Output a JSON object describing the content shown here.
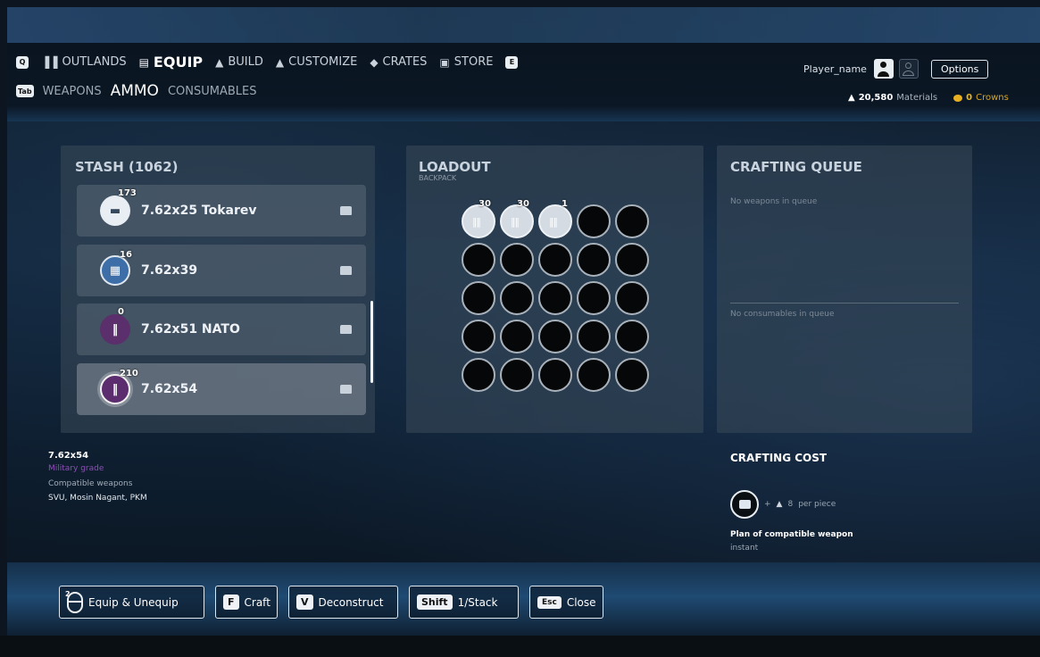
{
  "nav": {
    "prev_key": "Q",
    "next_key": "E",
    "tabs": [
      {
        "label": "OUTLANDS",
        "icon": "bars-icon"
      },
      {
        "label": "EQUIP",
        "icon": "gun-icon"
      },
      {
        "label": "BUILD",
        "icon": "house-icon"
      },
      {
        "label": "CUSTOMIZE",
        "icon": "helmet-icon"
      },
      {
        "label": "CRATES",
        "icon": "crate-icon"
      },
      {
        "label": "STORE",
        "icon": "store-icon"
      }
    ]
  },
  "subnav": {
    "key": "Tab",
    "tabs": [
      "WEAPONS",
      "AMMO",
      "CONSUMABLES"
    ]
  },
  "player": {
    "name": "Player_name",
    "options_label": "Options"
  },
  "currency": {
    "materials_value": "20,580",
    "materials_label": "Materials",
    "crowns_value": "0",
    "crowns_label": "Crowns",
    "crowns_color": "#e8b41e"
  },
  "stash": {
    "title": "STASH (1062)",
    "items": [
      {
        "name": "7.62x25 Tokarev",
        "count": "173",
        "icon": "bullet-icon"
      },
      {
        "name": "7.62x39",
        "count": "16",
        "icon": "magazine-icon"
      },
      {
        "name": "7.62x51 NATO",
        "count": "0",
        "icon": "cartridges-icon"
      },
      {
        "name": "7.62x54",
        "count": "210",
        "icon": "cartridges-icon"
      }
    ]
  },
  "loadout": {
    "title": "LOADOUT",
    "subtitle": "BACKPACK",
    "filled_counts": [
      "30",
      "30",
      "1"
    ]
  },
  "crafting_queue": {
    "title": "CRAFTING QUEUE",
    "weapons_empty": "No weapons in queue",
    "consumables_empty": "No consumables in queue"
  },
  "info": {
    "title": "7.62x54",
    "grade": "Military grade",
    "grade_color": "#8d4fb5",
    "compat_label": "Compatible weapons",
    "compat": "SVU, Mosin Nagant, PKM"
  },
  "crafting_cost": {
    "title": "CRAFTING COST",
    "plus": "+",
    "amount": "8",
    "per_piece": "per piece",
    "plan": "Plan of compatible weapon",
    "time": "instant"
  },
  "actions": {
    "mouse_tag": "2",
    "equip": "Equip & Unequip",
    "craft_key": "F",
    "craft": "Craft",
    "deconstruct_key": "V",
    "deconstruct": "Deconstruct",
    "stack_key": "Shift",
    "stack": "1/Stack",
    "close_key": "Esc",
    "close": "Close"
  }
}
